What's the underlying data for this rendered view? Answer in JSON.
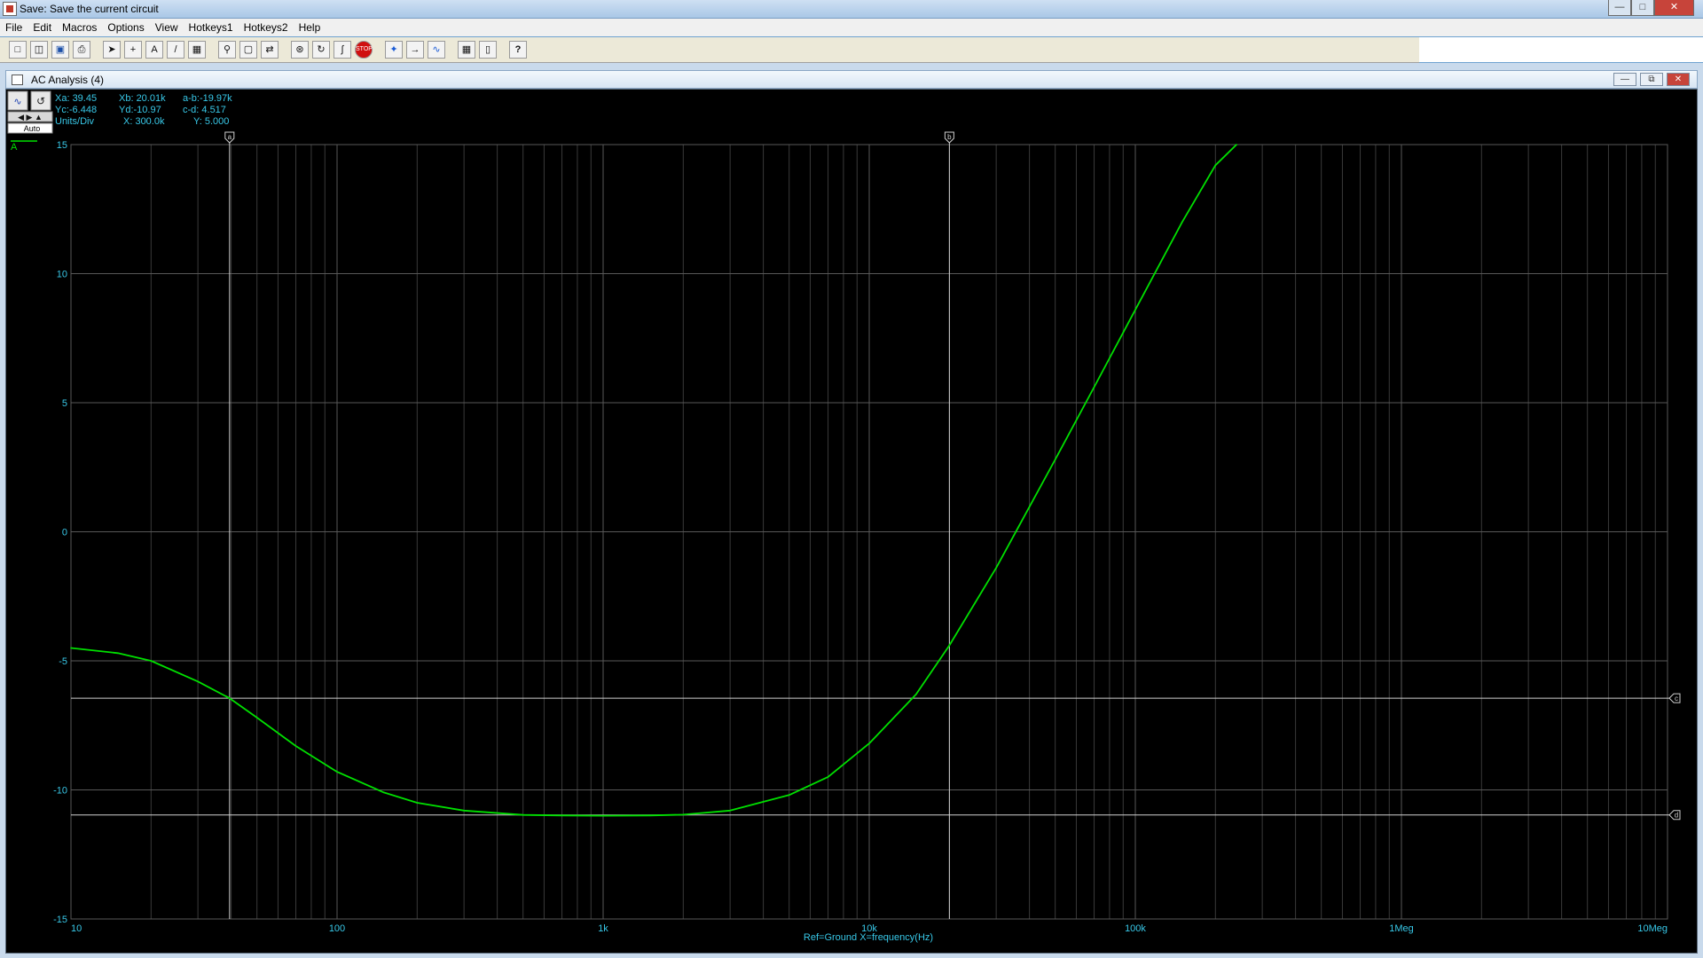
{
  "window": {
    "title": "Save: Save the current circuit"
  },
  "menu": [
    "File",
    "Edit",
    "Macros",
    "Options",
    "View",
    "Hotkeys1",
    "Hotkeys2",
    "Help"
  ],
  "toolbar": {
    "icons": [
      "new-file",
      "open-file",
      "save-file",
      "print",
      "pointer",
      "wire",
      "text",
      "pen",
      "component",
      "zoom",
      "zoom-area",
      "scale",
      "redraw",
      "refresh",
      "probe",
      "stop",
      "marker",
      "step",
      "analysis",
      "grid",
      "cursor-mode",
      "help"
    ],
    "stop_label": "STOP",
    "help_label": "?"
  },
  "child_window": {
    "title": "AC Analysis (4)"
  },
  "readout": {
    "xa": "Xa: 39.45",
    "xb": "Xb: 20.01k",
    "ab": "a-b:-19.97k",
    "yc": "Yc:-6.448",
    "yd": "Yd:-10.97",
    "cd": "c-d: 4.517",
    "units_label": "Units/Div",
    "x_units": "X: 300.0k",
    "y_units": "Y: 5.000",
    "mode_label": "Auto",
    "trace_label": "A"
  },
  "chart_data": {
    "type": "line",
    "title": "",
    "xlabel": "Ref=Ground  X=frequency(Hz)",
    "ylabel": "",
    "x_scale": "log",
    "xlim": [
      10,
      10000000
    ],
    "ylim": [
      -15,
      15
    ],
    "x_ticks": [
      10,
      100,
      1000,
      10000,
      100000,
      1000000,
      10000000
    ],
    "x_tick_labels": [
      "10",
      "100",
      "1k",
      "10k",
      "100k",
      "1Meg",
      "10Meg"
    ],
    "y_ticks": [
      15,
      10,
      5,
      0,
      -5,
      -10,
      -15
    ],
    "y_tick_labels": [
      "15",
      "10",
      "5",
      "0",
      "-5",
      "-10",
      "-15"
    ],
    "grid": true,
    "series": [
      {
        "name": "A",
        "color": "#00e000",
        "x": [
          10,
          15,
          20,
          30,
          39.45,
          50,
          70,
          100,
          150,
          200,
          300,
          500,
          700,
          1000,
          1500,
          2000,
          3000,
          5000,
          7000,
          10000,
          15000,
          20010,
          30000,
          50000,
          70000,
          100000,
          150000,
          200000,
          240000
        ],
        "y": [
          -4.5,
          -4.7,
          -5.0,
          -5.8,
          -6.448,
          -7.2,
          -8.3,
          -9.3,
          -10.1,
          -10.5,
          -10.8,
          -10.97,
          -10.99,
          -11.0,
          -10.99,
          -10.96,
          -10.8,
          -10.2,
          -9.5,
          -8.2,
          -6.3,
          -4.4,
          -1.4,
          2.8,
          5.6,
          8.6,
          12.0,
          14.2,
          15.0
        ]
      }
    ],
    "cursors": {
      "a_x": 39.45,
      "b_x": 20010,
      "c_y": -6.448,
      "d_y": -10.97
    },
    "cursor_labels": {
      "a": "a",
      "b": "b",
      "c": "c",
      "d": "d"
    }
  }
}
